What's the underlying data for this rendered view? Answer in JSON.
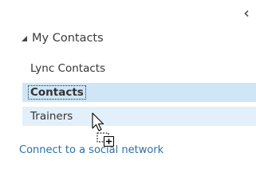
{
  "nav": {
    "collapse_icon": "chevron-left-icon",
    "group": {
      "expand_icon": "triangle-down-icon",
      "label": "My Contacts",
      "items": [
        {
          "label": "Lync Contacts",
          "state": "normal"
        },
        {
          "label": "Contacts",
          "state": "selected"
        },
        {
          "label": "Trainers",
          "state": "drop-target-hover"
        }
      ]
    },
    "social_link": "Connect to a social network"
  },
  "cursor": {
    "icon": "drag-copy-cursor-icon"
  },
  "colors": {
    "selected_bg": "#cfe6f7",
    "hover_bg": "#e3f0fa",
    "link": "#2b6fa8",
    "text": "#333333"
  }
}
